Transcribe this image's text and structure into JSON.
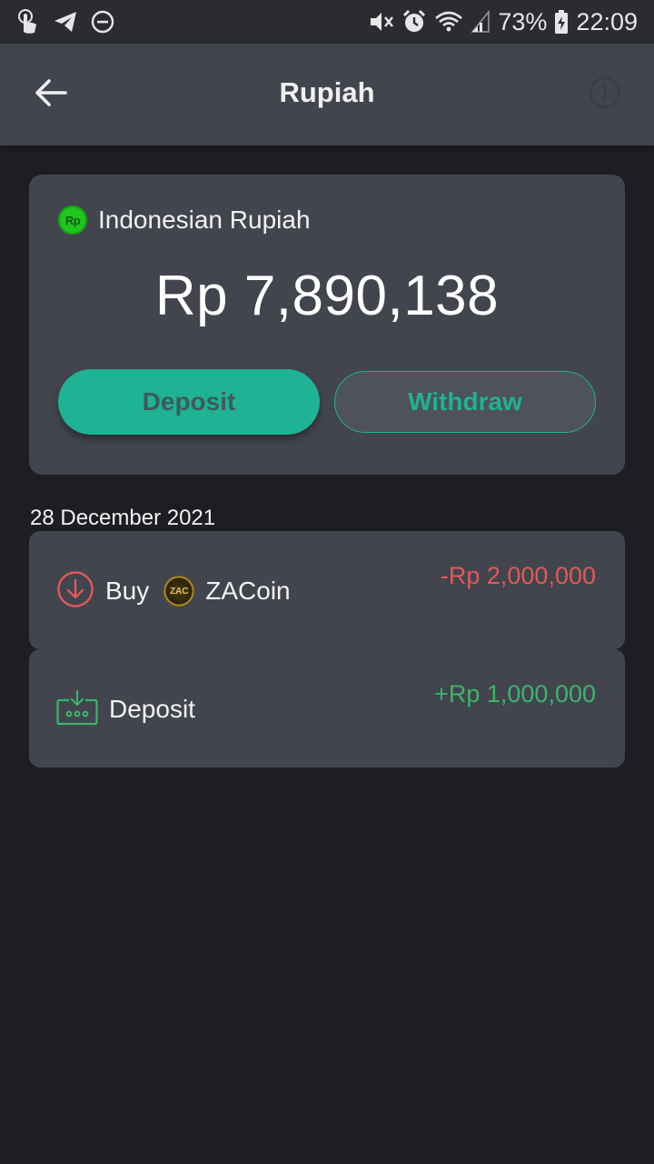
{
  "status_bar": {
    "battery": "73%",
    "time": "22:09"
  },
  "app_bar": {
    "title": "Rupiah"
  },
  "balance_card": {
    "currency_badge": "Rp",
    "currency_name": "Indonesian Rupiah",
    "amount": "Rp 7,890,138",
    "deposit_label": "Deposit",
    "withdraw_label": "Withdraw"
  },
  "transactions": {
    "date": "28 December 2021",
    "items": [
      {
        "type_label": "Buy",
        "coin_name": "ZACoin",
        "coin_badge": "ZAC",
        "amount": "-Rp 2,000,000",
        "icon": "arrow-down-circle-icon"
      },
      {
        "type_label": "Deposit",
        "amount": "+Rp 1,000,000",
        "icon": "deposit-tray-icon"
      }
    ]
  },
  "colors": {
    "accent": "#1eb394",
    "negative": "#e05a57",
    "positive": "#3bb56b",
    "card": "#42454d",
    "background": "#1d1e22"
  }
}
